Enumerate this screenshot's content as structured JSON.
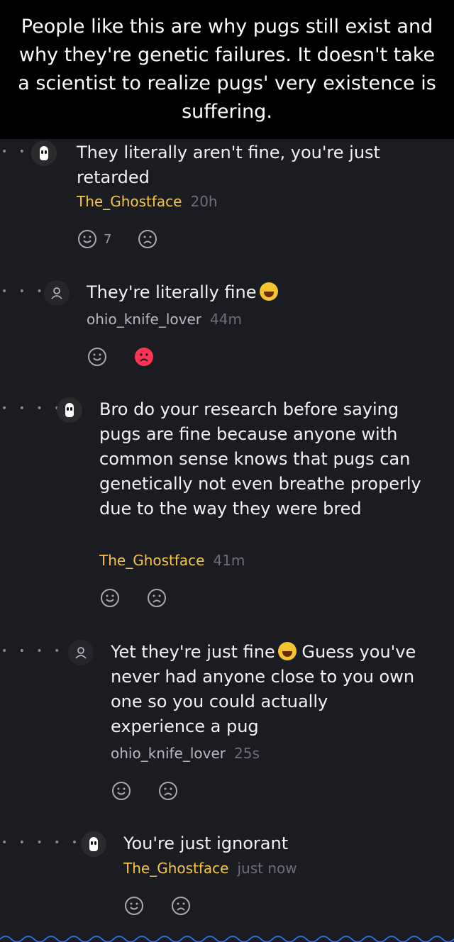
{
  "caption": "People like this are why pugs still exist and why they're genetic failures. It doesn't take a scientist to realize pugs' very existence is suffering.",
  "comments": [
    {
      "text": "They literally aren't fine, you're just retarded",
      "user": "The_Ghostface",
      "time": "20h",
      "likes": "7"
    },
    {
      "text": "They're literally fine",
      "user": "ohio_knife_lover",
      "time": "44m",
      "likes": ""
    },
    {
      "text": "Bro do your research before saying pugs are fine because anyone with common sense knows that pugs can genetically not even breathe properly due to the way they were bred",
      "user": "The_Ghostface",
      "time": "41m",
      "likes": ""
    },
    {
      "text": "Yet they're just fine",
      "text2": "Guess you've never had anyone close to you own one so you could actually experience a pug",
      "user": "ohio_knife_lover",
      "time": "25s",
      "likes": ""
    },
    {
      "text": "You're just ignorant",
      "user": "The_Ghostface",
      "time": "just now",
      "likes": ""
    }
  ],
  "colors": {
    "background": "#1b1c21",
    "ghostface_username": "#f7c548",
    "dislike_active": "#ff3355"
  },
  "icons": {
    "like": "smile-face-icon",
    "dislike": "frown-face-icon"
  }
}
